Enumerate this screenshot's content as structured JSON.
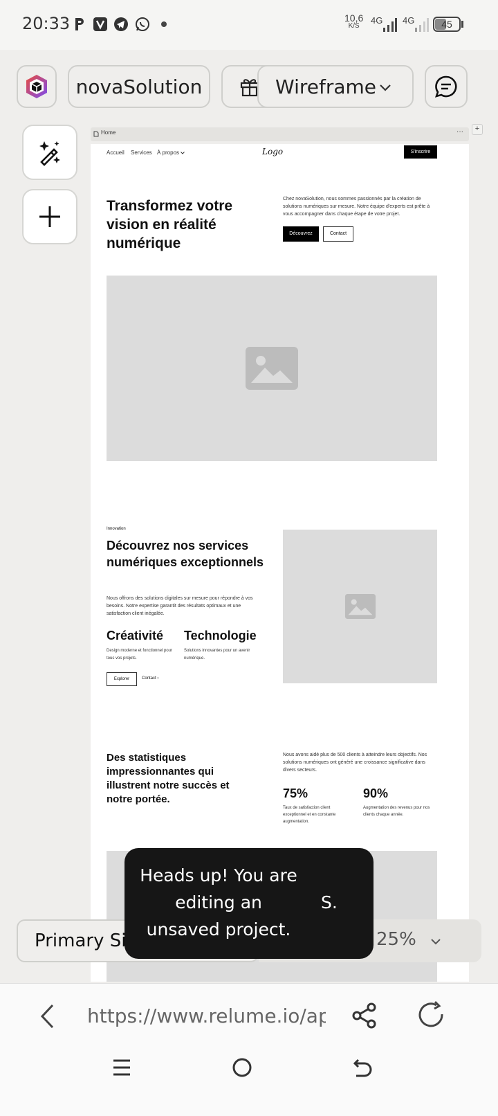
{
  "status": {
    "time": "20:33",
    "speed_value": "10,6",
    "speed_unit": "K/S",
    "net1": "4G",
    "net2": "4G",
    "battery": "45"
  },
  "toolbar": {
    "project": "novaSolution",
    "mode": "Wireframe"
  },
  "frame": {
    "tab": "Home",
    "more": "···"
  },
  "site": {
    "nav": [
      "Accueil",
      "Services",
      "À propos"
    ],
    "logo": "Logo",
    "signup": "S'inscrire",
    "hero": {
      "title": "Transformez votre vision en réalité numérique",
      "body": "Chez novaSolution, nous sommes passionnés par la création de solutions numériques sur mesure. Notre équipe d'experts est prête à vous accompagner dans chaque étape de votre projet.",
      "primary": "Découvrez",
      "secondary": "Contact"
    },
    "features": {
      "tag": "Innovation",
      "title": "Découvrez nos services numériques exceptionnels",
      "body": "Nous offrons des solutions digitales sur mesure pour répondre à vos besoins. Notre expertise garantit des résultats optimaux et une satisfaction client inégalée.",
      "col1_title": "Créativité",
      "col1_text": "Design moderne et fonctionnel pour tous vos projets.",
      "col2_title": "Technologie",
      "col2_text": "Solutions innovantes pour un avenir numérique.",
      "btn1": "Explorer",
      "btn2": "Contact"
    },
    "stats": {
      "title": "Des statistiques impressionnantes qui illustrent notre succès et notre portée.",
      "body": "Nous avons aidé plus de 500 clients à atteindre leurs objectifs. Nos solutions numériques ont généré une croissance significative dans divers secteurs.",
      "stat1_value": "75%",
      "stat1_text": "Taux de satisfaction client exceptionnel et en constante augmentation.",
      "stat2_value": "90%",
      "stat2_text": "Augmentation des revenus pour nos clients chaque année."
    }
  },
  "bottom": {
    "page_select": "Primary Si",
    "zoom": "25%",
    "hidden_suffix": "S."
  },
  "toast": {
    "message": "Heads up! You are editing an unsaved project."
  },
  "browser": {
    "url": "https://www.relume.io/app..."
  }
}
